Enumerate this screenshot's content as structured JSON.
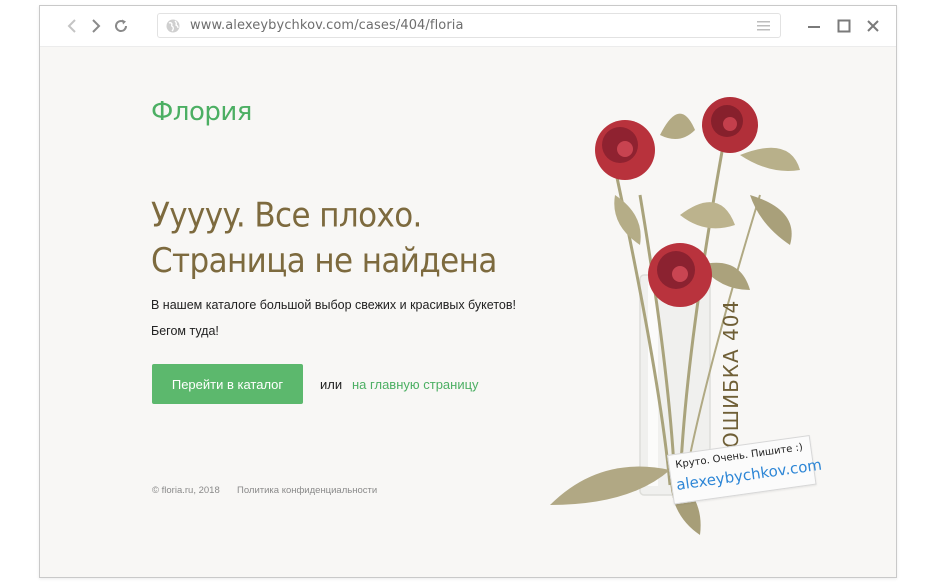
{
  "browser": {
    "url": "www.alexeybychkov.com/cases/404/floria"
  },
  "page": {
    "logo": "Флория",
    "heading_line1": "Уyyyy. Все плохо.",
    "heading_line2": "Страница не найдена",
    "desc_line1": "В нашем каталоге большой выбор свежих и красивых букетов!",
    "desc_line2": "Бегом туда!",
    "catalog_button": "Перейти в каталог",
    "or_text": "или",
    "home_link": "на главную страницу",
    "footer_copyright": "© floria.ru, 2018",
    "footer_privacy": "Политика конфиденциальности",
    "vase_label": "ОШИБКА 404",
    "tag_line1": "Круто. Очень. Пишите :)",
    "tag_line2": "alexeybychkov.com"
  },
  "colors": {
    "brand_green": "#4caf63",
    "button_green": "#5cb86d",
    "heading_brown": "#7d6a3e",
    "link_blue": "#2d86d6"
  }
}
